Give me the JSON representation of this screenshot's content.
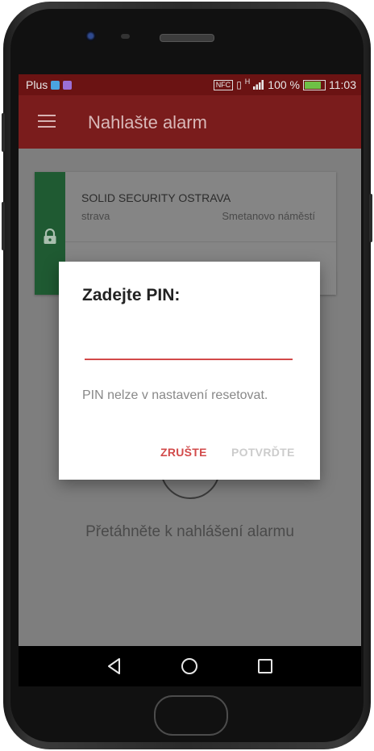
{
  "status_bar": {
    "carrier": "Plus",
    "nfc": "NFC",
    "network": "H",
    "battery_percent": "100 %",
    "time": "11:03",
    "battery_color": "#6ec146"
  },
  "app_bar": {
    "title": "Nahlašte alarm",
    "menu_icon": "hamburger-icon"
  },
  "card": {
    "name": "SOLID SECURITY OSTRAVA",
    "city": "strava",
    "street": "Smetanovo náměstí",
    "status_icon": "lock-icon",
    "status_color": "#1f5a32"
  },
  "swipe_hint": "Přetáhněte k nahlášení alarmu",
  "dialog": {
    "title": "Zadejte PIN:",
    "pin_value": "",
    "message": "PIN nelze v nastavení resetovat.",
    "cancel_label": "ZRUŠTE",
    "confirm_label": "POTVRĎTE",
    "accent_color": "#d24a4a"
  },
  "nav_bar": {
    "back_icon": "back-triangle-icon",
    "home_icon": "home-circle-icon",
    "recents_icon": "recents-square-icon"
  }
}
